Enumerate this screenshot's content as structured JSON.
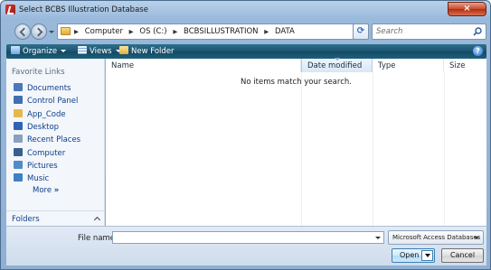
{
  "window": {
    "title": "Select BCBS Illustration Database",
    "close_glyph": "×"
  },
  "address": {
    "crumbs": [
      "Computer",
      "OS (C:)",
      "BCBSILLUSTRATION",
      "DATA"
    ],
    "separator": "▶",
    "refresh_glyph": "⟳"
  },
  "search": {
    "placeholder": "Search"
  },
  "toolbar": {
    "organize_label": "Organize",
    "views_label": "Views",
    "new_folder_label": "New Folder",
    "help_glyph": "?"
  },
  "nav": {
    "heading": "Favorite Links",
    "items": [
      {
        "label": "Documents",
        "icon": "documents-icon",
        "color": "#4a78b8"
      },
      {
        "label": "Control Panel",
        "icon": "control-panel-icon",
        "color": "#3f6fb0"
      },
      {
        "label": "App_Code",
        "icon": "folder-icon",
        "color": "#e6b84a"
      },
      {
        "label": "Desktop",
        "icon": "desktop-icon",
        "color": "#2f62b5"
      },
      {
        "label": "Recent Places",
        "icon": "recent-places-icon",
        "color": "#8aa0bd"
      },
      {
        "label": "Computer",
        "icon": "computer-icon",
        "color": "#3a5f8f"
      },
      {
        "label": "Pictures",
        "icon": "pictures-icon",
        "color": "#4f8bc9"
      },
      {
        "label": "Music",
        "icon": "music-icon",
        "color": "#3f7fc4"
      }
    ],
    "more_label": "More",
    "more_glyph": "»",
    "folders_label": "Folders"
  },
  "columns": {
    "name": "Name",
    "date": "Date modified",
    "type": "Type",
    "size": "Size"
  },
  "empty_message": "No items match your search.",
  "bottom": {
    "filename_label": "File name:",
    "filename_value": "",
    "filetype_value": "Microsoft Access Databases",
    "open_label": "Open",
    "cancel_label": "Cancel"
  }
}
